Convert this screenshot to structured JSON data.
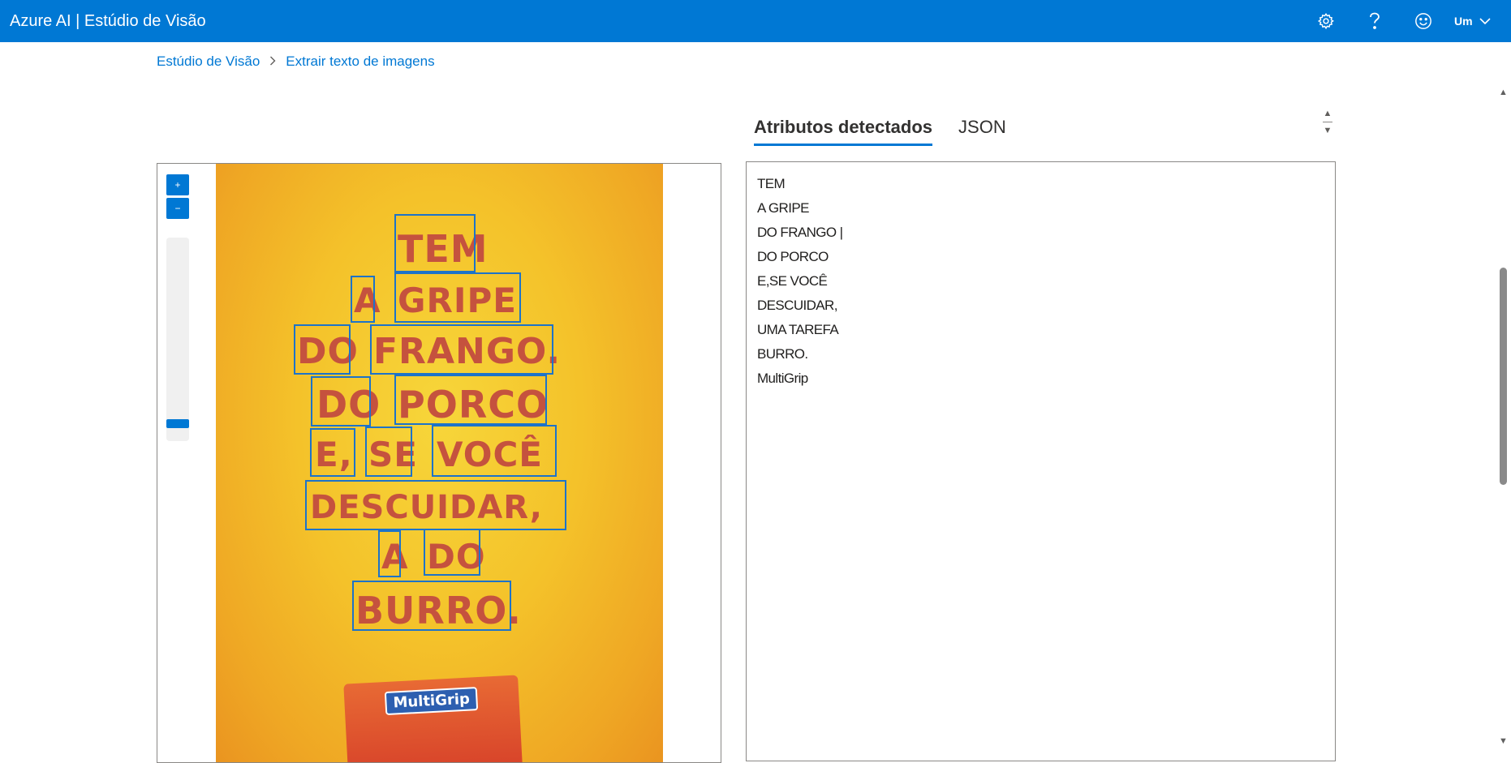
{
  "header": {
    "title": "Azure AI | Estúdio de Visão",
    "user_label": "Um",
    "icons": [
      "gear-icon",
      "help-icon",
      "smiley-icon",
      "chevron-down-icon"
    ],
    "bar_color": "#0078d4"
  },
  "breadcrumb": {
    "items": [
      "Estúdio de Visão",
      "Extrair texto de imagens"
    ]
  },
  "image_panel": {
    "zoom_in": "+",
    "zoom_out": "−",
    "ad_words": [
      "TEM",
      "A",
      "GRIPE",
      "DO",
      "FRANGO.",
      "DO",
      "PORCO",
      "E,",
      "SE",
      "VOCÊ",
      "DESCUIDAR,",
      "A",
      "DO",
      "BURRO."
    ],
    "product_label": "MultiGrip"
  },
  "results": {
    "tabs": [
      "Atributos detectados",
      "JSON"
    ],
    "active_tab": "Atributos detectados",
    "lines": [
      "TEM",
      "A GRIPE",
      "DO FRANGO |",
      "DO PORCO",
      "E,SE  VOCÊ",
      "DESCUIDAR,",
      "UMA TAREFA",
      "BURRO.",
      "MultiGrip"
    ]
  }
}
